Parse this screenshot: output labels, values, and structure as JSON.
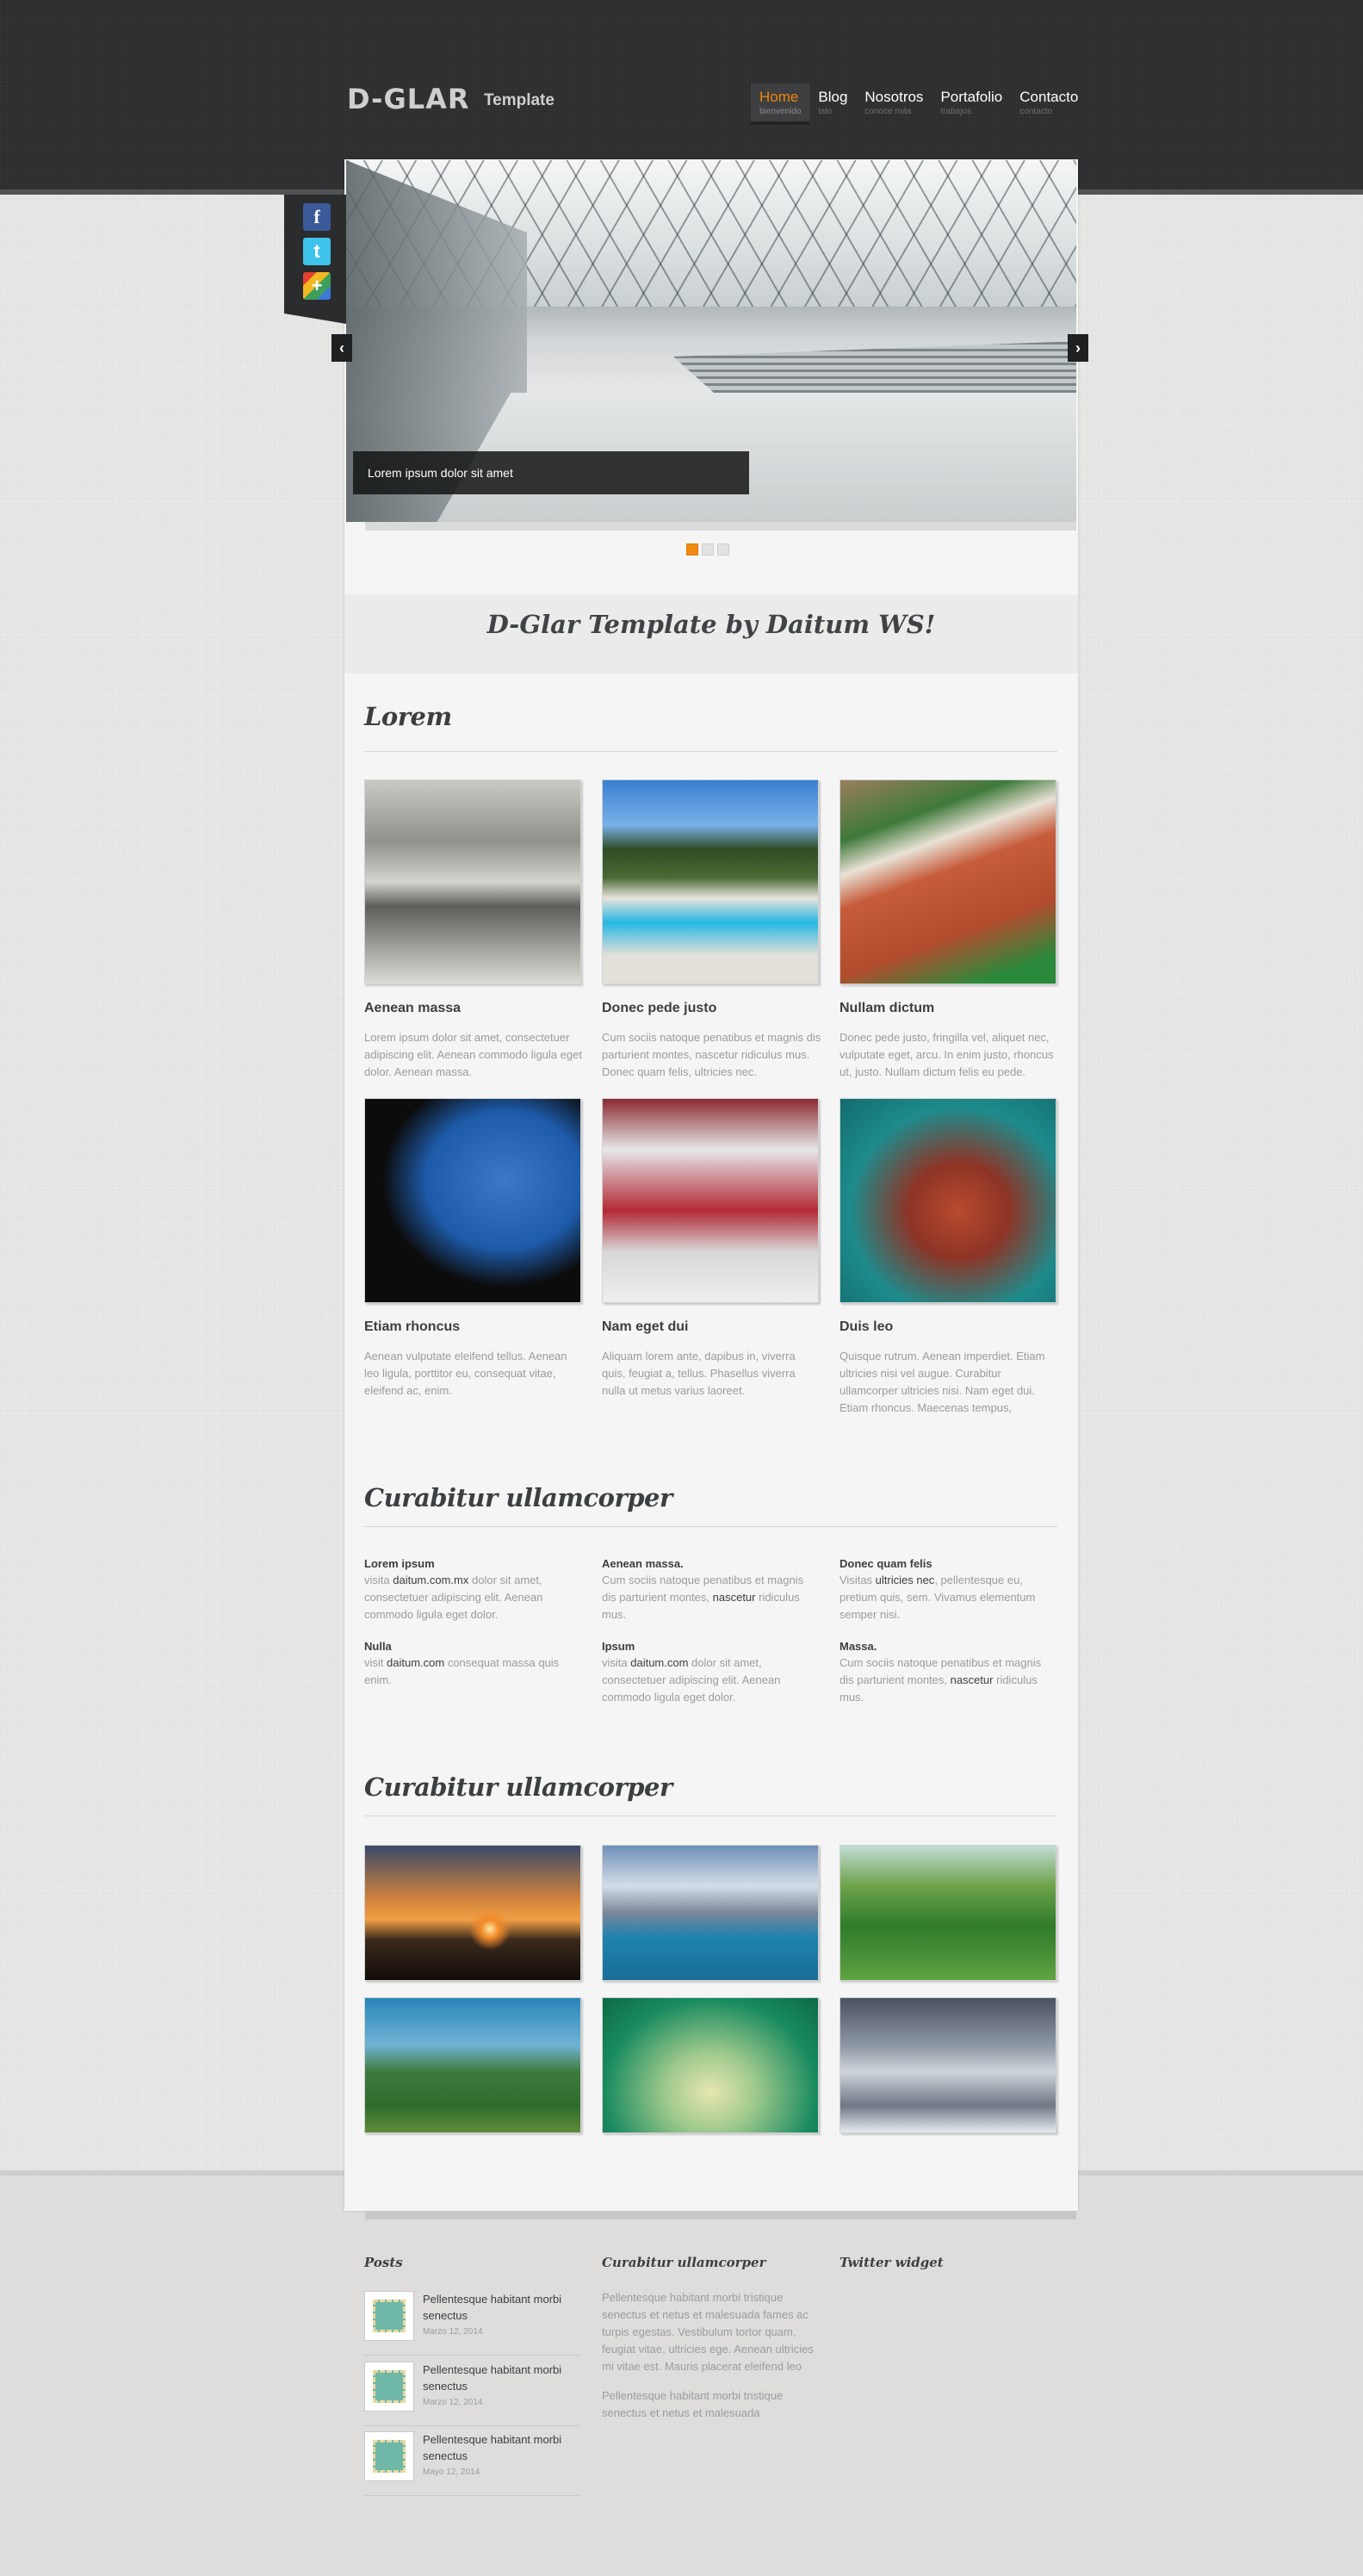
{
  "header": {
    "logo_mark": "D-GLAR",
    "logo_sub": "Template",
    "nav": [
      {
        "label": "Home",
        "sub": "bienvenido"
      },
      {
        "label": "Blog",
        "sub": "lalo"
      },
      {
        "label": "Nosotros",
        "sub": "conoce más"
      },
      {
        "label": "Portafolio",
        "sub": "trabajos"
      },
      {
        "label": "Contacto",
        "sub": "contacto"
      }
    ]
  },
  "slider": {
    "caption": "Lorem ipsum dolor sit amet",
    "prev": "‹",
    "next": "›",
    "dots": 3,
    "active_dot": 0,
    "accent": "#f08a12"
  },
  "social": [
    "f",
    "t",
    "+"
  ],
  "tagline": "D-Glar Template by Daitum WS!",
  "lorem_section": {
    "title": "Lorem",
    "cards": [
      {
        "title": "Aenean massa",
        "text": "Lorem ipsum dolor sit amet, consectetuer adipiscing elit. Aenean commodo ligula eget dolor. Aenean massa."
      },
      {
        "title": "Donec pede justo",
        "text": "Cum sociis natoque penatibus et magnis dis parturient montes, nascetur ridiculus mus. Donec quam felis, ultricies nec."
      },
      {
        "title": "Nullam dictum",
        "text": "Donec pede justo, fringilla vel, aliquet nec, vulputate eget, arcu. In enim justo, rhoncus ut, justo. Nullam dictum felis eu pede."
      },
      {
        "title": "Etiam rhoncus",
        "text": "Aenean vulputate eleifend tellus. Aenean leo ligula, porttitor eu, consequat vitae, eleifend ac, enim."
      },
      {
        "title": "Nam eget dui",
        "text": "Aliquam lorem ante, dapibus in, viverra quis, feugiat a, tellus. Phasellus viverra nulla ut metus varius laoreet."
      },
      {
        "title": "Duis leo",
        "text": "Quisque rutrum. Aenean imperdiet. Etiam ultricies nisi vel augue. Curabitur ullamcorper ultricies nisi. Nam eget dui. Etiam rhoncus. Maecenas tempus,"
      }
    ]
  },
  "info_section": {
    "title": "Curabitur ullamcorper",
    "items": [
      {
        "title": "Lorem ipsum",
        "pre": "visita ",
        "bold": "daitum.com.mx",
        "post": " dolor sit amet, consectetuer adipiscing elit. Aenean commodo ligula eget dolor."
      },
      {
        "title": "Aenean massa.",
        "pre": "Cum sociis natoque penatibus et magnis dis parturient montes, ",
        "bold": "nascetur",
        "post": " ridiculus mus."
      },
      {
        "title": "Donec quam felis",
        "pre": "Visitas ",
        "bold": "ultricies nec",
        "post": ", pellentesque eu, pretium quis, sem. Vivamus elementum semper nisi."
      },
      {
        "title": "Nulla",
        "pre": "visit ",
        "bold": "daitum.com",
        "post": " consequat massa quis enim."
      },
      {
        "title": "Ipsum",
        "pre": "visita ",
        "bold": "daitum.com",
        "post": " dolor sit amet, consectetuer adipiscing elit. Aenean commodo ligula eget dolor."
      },
      {
        "title": "Massa.",
        "pre": "Cum sociis natoque penatibus et magnis dis parturient montes, ",
        "bold": "nascetur",
        "post": " ridiculus mus."
      }
    ]
  },
  "gallery_section": {
    "title": "Curabitur ullamcorper"
  },
  "footer": {
    "posts_title": "Posts",
    "posts": [
      {
        "title": "Pellentesque habitant morbi senectus",
        "date": "Marzo 12, 2014"
      },
      {
        "title": "Pellentesque habitant morbi senectus",
        "date": "Marzo 12, 2014"
      },
      {
        "title": "Pellentesque habitant morbi senectus",
        "date": "Mayo 12, 2014"
      }
    ],
    "middle_title": "Curabitur ullamcorper",
    "middle_text_1": "Pellentesque habitant morbi tristique senectus et netus et malesuada fames ac turpis egestas. Vestibulum tortor quam, feugiat vitae, ultricies ege. Aenean ultricies mi vitae est. Mauris placerat eleifend leo",
    "middle_text_2": "Pellentesque habitant morbi tristique senectus et netus et malesuada",
    "twitter_title": "Twitter widget"
  }
}
